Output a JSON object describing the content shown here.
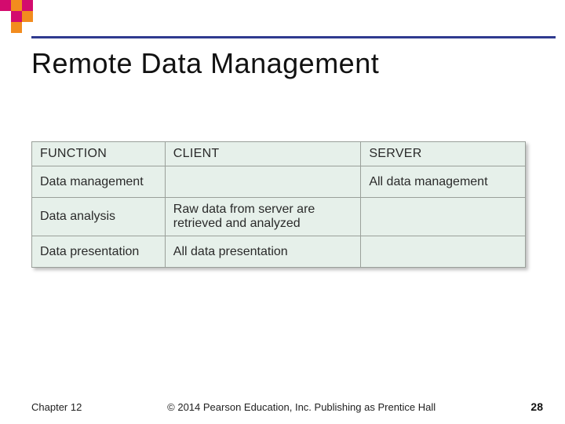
{
  "title": "Remote Data Management",
  "table": {
    "headers": [
      "FUNCTION",
      "CLIENT",
      "SERVER"
    ],
    "rows": [
      {
        "function": "Data management",
        "client": "",
        "server": "All data management"
      },
      {
        "function": "Data analysis",
        "client": "Raw data from server are retrieved and analyzed",
        "server": ""
      },
      {
        "function": "Data presentation",
        "client": "All data presentation",
        "server": ""
      }
    ]
  },
  "footer": {
    "chapter": "Chapter 12",
    "copyright": "© 2014 Pearson Education, Inc. Publishing as Prentice Hall",
    "page": "28"
  },
  "decor_colors": {
    "magenta": "#d30b6e",
    "orange": "#f28c1e",
    "blue": "#2f3a8f"
  }
}
